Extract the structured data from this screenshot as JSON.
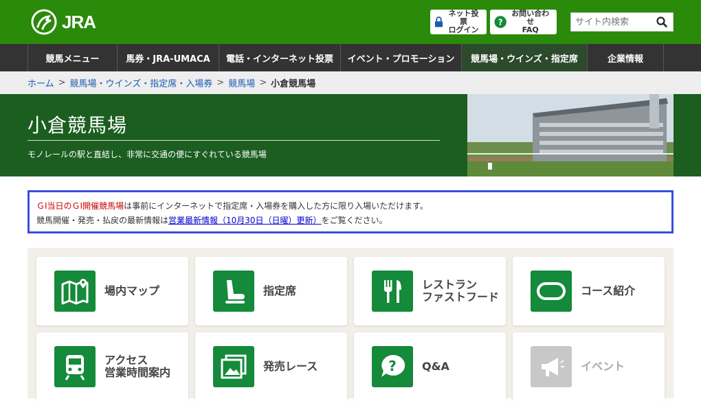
{
  "header": {
    "logo_text": "JRA",
    "login_btn": {
      "line1": "ネット投票",
      "line2": "ログイン"
    },
    "faq_btn": {
      "line1": "お問い合わせ",
      "line2": "FAQ"
    },
    "search_placeholder": "サイト内検索"
  },
  "nav": {
    "items": [
      {
        "label": "競馬メニュー"
      },
      {
        "label": "馬券・JRA-UMACA"
      },
      {
        "label": "電話・インターネット投票"
      },
      {
        "label": "イベント・プロモーション"
      },
      {
        "label": "競馬場・ウインズ・指定席"
      },
      {
        "label": "企業情報"
      }
    ],
    "active_index": 4
  },
  "breadcrumb": {
    "items": [
      "ホーム",
      "競馬場・ウインズ・指定席・入場券",
      "競馬場"
    ],
    "current": "小倉競馬場",
    "separator": ">"
  },
  "hero": {
    "title": "小倉競馬場",
    "subtitle": "モノレールの駅と直結し、非常に交通の便にすぐれている競馬場"
  },
  "notice": {
    "line1_red": "ＧⅠ当日のＧⅠ開催競馬場",
    "line1_rest": "は事前にインターネットで指定席・入場券を購入した方に限り入場いただけます。",
    "line2_prefix": "競馬開催・発売・払戻の最新情報は",
    "line2_link": "営業最新情報（10月30日（日曜）更新）",
    "line2_suffix": "をご覧ください。"
  },
  "tiles": [
    {
      "label": "場内マップ",
      "icon": "map-icon"
    },
    {
      "label": "指定席",
      "icon": "seat-icon"
    },
    {
      "label": "レストラン\nファストフード",
      "icon": "restaurant-icon"
    },
    {
      "label": "コース紹介",
      "icon": "course-icon"
    },
    {
      "label": "アクセス\n営業時間案内",
      "icon": "train-icon"
    },
    {
      "label": "発売レース",
      "icon": "race-photo-icon"
    },
    {
      "label": "Q&A",
      "icon": "question-icon"
    },
    {
      "label": "イベント",
      "icon": "megaphone-icon",
      "disabled": true
    }
  ],
  "colors": {
    "brand_green": "#2a8a0a",
    "nav_bg": "#333333",
    "hero_bg": "#1b5e20",
    "tile_icon_green": "#148a3a",
    "notice_border": "#3a4ddb"
  }
}
